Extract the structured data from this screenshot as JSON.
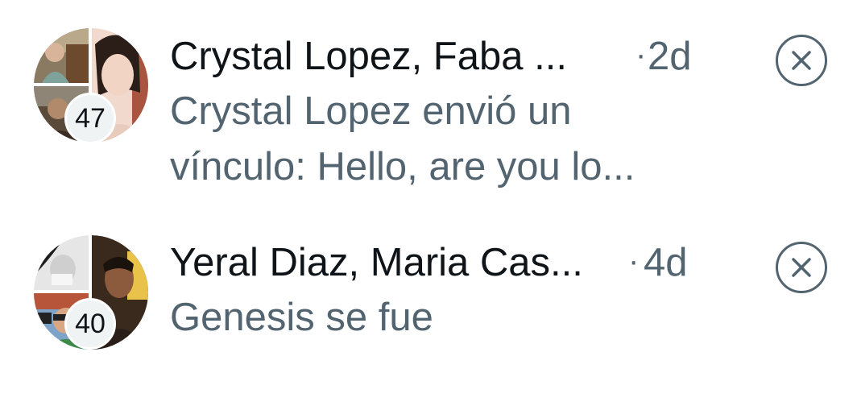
{
  "conversations": [
    {
      "participants": "Crystal Lopez, Faba ...",
      "separator": "·",
      "time": "2d",
      "preview": "Crystal Lopez envió un vínculo: Hello, are you lo...",
      "member_count": "47",
      "dismiss_icon": "close-circle-icon"
    },
    {
      "participants": "Yeral Diaz, Maria Cas...",
      "separator": "·",
      "time": "4d",
      "preview": "Genesis se fue",
      "member_count": "40",
      "dismiss_icon": "close-circle-icon"
    }
  ],
  "colors": {
    "primary_text": "#0f1419",
    "secondary_text": "#536471",
    "badge_bg": "#eff3f4"
  }
}
